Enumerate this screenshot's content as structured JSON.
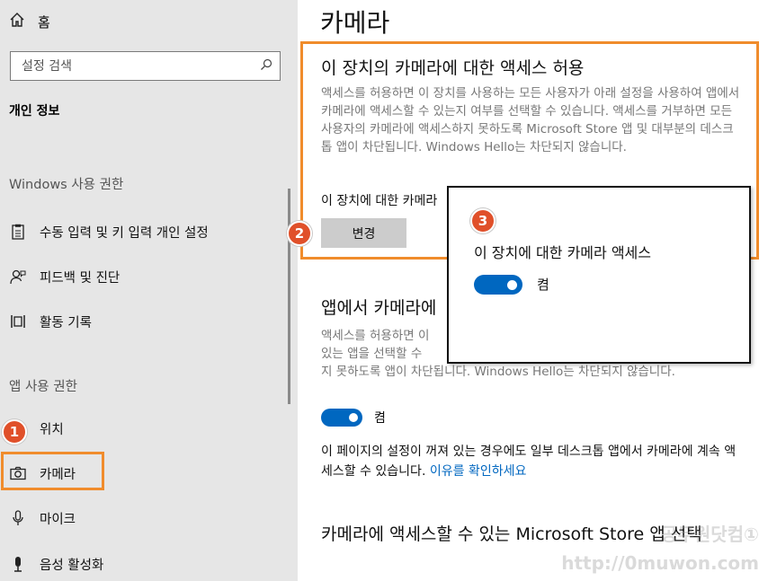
{
  "sidebar": {
    "home_label": "홈",
    "search_placeholder": "설정 검색",
    "section_title": "개인 정보",
    "group_windows": "Windows 사용 권한",
    "group_app": "앱 사용 권한",
    "items": [
      {
        "label": "수동 입력 및 키 입력 개인 설정",
        "icon": "clipboard-icon"
      },
      {
        "label": "피드백 및 진단",
        "icon": "person-feedback-icon"
      },
      {
        "label": "활동 기록",
        "icon": "timeline-icon"
      },
      {
        "label": "위치",
        "icon": "location-icon"
      },
      {
        "label": "카메라",
        "icon": "camera-icon"
      },
      {
        "label": "마이크",
        "icon": "microphone-icon"
      },
      {
        "label": "음성 활성화",
        "icon": "voice-icon"
      }
    ]
  },
  "main": {
    "page_title": "카메라",
    "device_section": {
      "title": "이 장치의 카메라에 대한 액세스 허용",
      "desc": "액세스를 허용하면 이 장치를 사용하는 모든 사용자가 아래 설정을 사용하여 앱에서 카메라에 액세스할 수 있는지 여부를 선택할 수 있습니다. 액세스를 거부하면 모든 사용자의 카메라에 액세스하지 못하도록 Microsoft Store 앱 및 대부분의 데스크톱 앱이 차단됩니다. Windows Hello는 차단되지 않습니다.",
      "status_partial": "이 장치에 대한 카메라",
      "change_button": "변경"
    },
    "app_section": {
      "title_partial": "앱에서 카메라에",
      "desc_line1": "액세스를 허용하면 이",
      "desc_line2": "있는 앱을 선택할 수",
      "desc_line3": "지 못하도록 앱이 차단됩니다. Windows Hello는 차단되지 않습니다.",
      "toggle_label": "켬",
      "note": "이 페이지의 설정이 꺼져 있는 경우에도 일부 데스크톱 앱에서 카메라에 계속 액세스할 수 있습니다.",
      "note_link": "이유를 확인하세요"
    },
    "store_section": {
      "title": "카메라에 액세스할 수 있는 Microsoft Store 앱 선택"
    }
  },
  "popup": {
    "title": "이 장치에 대한 카메라 액세스",
    "toggle_label": "켬"
  },
  "badges": [
    "1",
    "2",
    "3"
  ],
  "watermark": {
    "line1": "공무원닷컴①",
    "line2": "http://0muwon.com"
  },
  "colors": {
    "accent": "#0067c0",
    "highlight": "#f08c2c",
    "badge": "#e0502a",
    "sidebar_bg": "#e6e6e6"
  }
}
